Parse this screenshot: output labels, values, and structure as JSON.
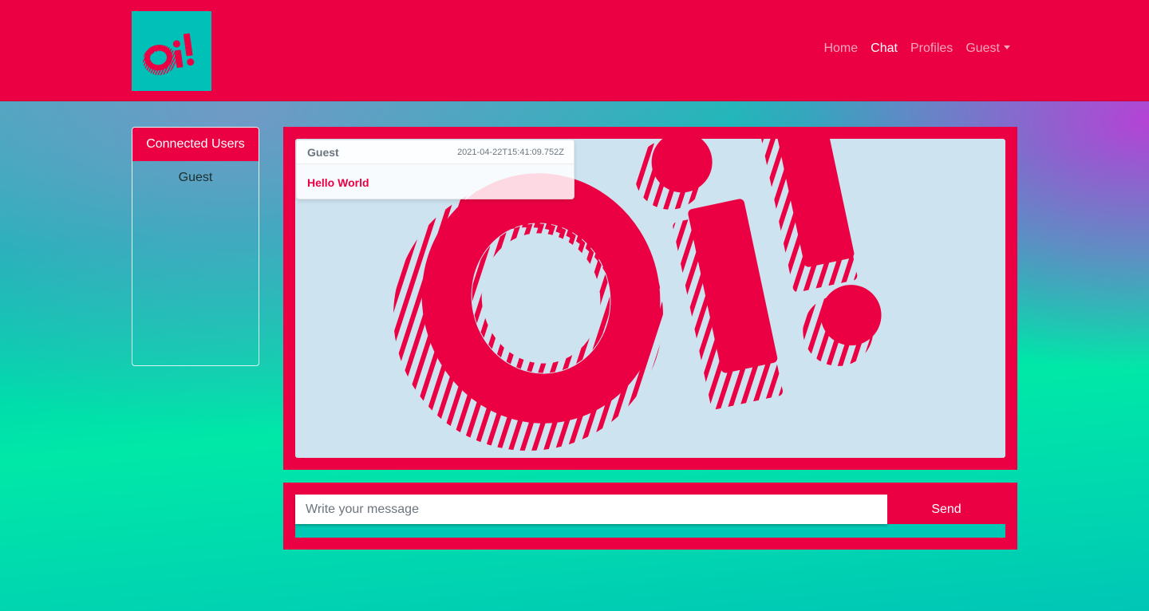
{
  "brand": {
    "logo_text": "Oi!"
  },
  "nav": {
    "items": [
      {
        "label": "Home",
        "active": false
      },
      {
        "label": "Chat",
        "active": true
      },
      {
        "label": "Profiles",
        "active": false
      },
      {
        "label": "Guest",
        "active": false,
        "dropdown": true
      }
    ]
  },
  "users_panel": {
    "title": "Connected Users",
    "users": [
      "Guest"
    ]
  },
  "chat": {
    "messages": [
      {
        "user": "Guest",
        "timestamp": "2021-04-22T15:41:09.752Z",
        "text": "Hello World"
      }
    ]
  },
  "composer": {
    "placeholder": "Write your message",
    "send_label": "Send"
  },
  "colors": {
    "brand_red": "#ea0043",
    "brand_teal": "#00c0b8",
    "chat_background": "#cde3ef"
  }
}
